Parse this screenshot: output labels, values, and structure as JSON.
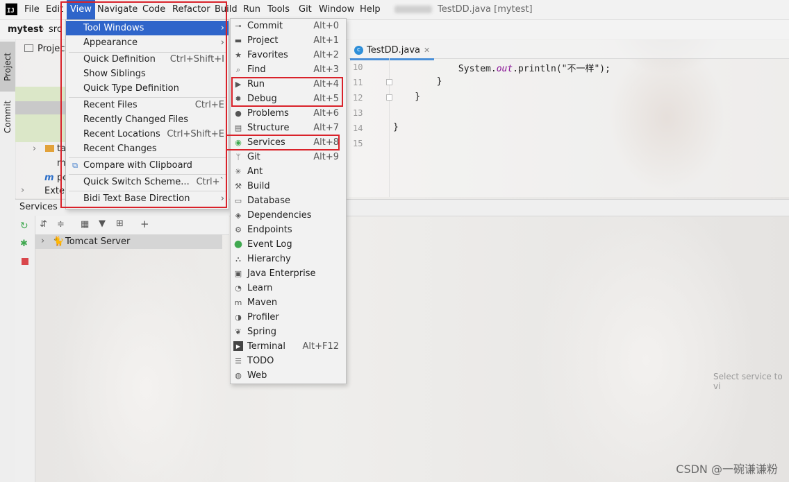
{
  "menubar": {
    "items": [
      "File",
      "Edit",
      "View",
      "Navigate",
      "Code",
      "Refactor",
      "Build",
      "Run",
      "Tools",
      "Git",
      "Window",
      "Help"
    ],
    "window_title": "TestDD.java [mytest]"
  },
  "navbar": {
    "project": "mytest",
    "crumb": "src"
  },
  "left_strip": {
    "project_tab": "Project",
    "commit_tab": "Commit"
  },
  "project_panel": {
    "header": "Project",
    "rows": [
      "ta",
      "m",
      "pc",
      "Exter"
    ]
  },
  "editor": {
    "tab_label": "TestDD.java",
    "lines": [
      {
        "num": "10",
        "code": "            System.out.println(\"不一样\");"
      },
      {
        "num": "11",
        "code": "        }"
      },
      {
        "num": "12",
        "code": "    }"
      },
      {
        "num": "13",
        "code": ""
      },
      {
        "num": "14",
        "code": "}"
      },
      {
        "num": "15",
        "code": ""
      }
    ],
    "out_token": "out"
  },
  "services": {
    "title": "Services",
    "tree_item": "Tomcat Server",
    "empty_hint": "Select service to vi"
  },
  "view_menu": {
    "items": [
      {
        "label": "Tool Windows",
        "shortcut": "",
        "submenu": true,
        "highlighted": true
      },
      {
        "label": "Appearance",
        "shortcut": "",
        "submenu": true
      },
      {
        "label": "Quick Definition",
        "shortcut": "Ctrl+Shift+I"
      },
      {
        "label": "Show Siblings",
        "shortcut": ""
      },
      {
        "label": "Quick Type Definition",
        "shortcut": ""
      },
      {
        "label": "Recent Files",
        "shortcut": "Ctrl+E"
      },
      {
        "label": "Recently Changed Files",
        "shortcut": ""
      },
      {
        "label": "Recent Locations",
        "shortcut": "Ctrl+Shift+E"
      },
      {
        "label": "Recent Changes",
        "shortcut": ""
      },
      {
        "label": "Compare with Clipboard",
        "shortcut": ""
      },
      {
        "label": "Quick Switch Scheme...",
        "shortcut": "Ctrl+`"
      },
      {
        "label": "Bidi Text Base Direction",
        "shortcut": "",
        "submenu": true
      }
    ]
  },
  "tool_windows_menu": {
    "items": [
      {
        "label": "Commit",
        "shortcut": "Alt+0",
        "icon": "commit-icon"
      },
      {
        "label": "Project",
        "shortcut": "Alt+1",
        "icon": "folder-icon"
      },
      {
        "label": "Favorites",
        "shortcut": "Alt+2",
        "icon": "star-icon"
      },
      {
        "label": "Find",
        "shortcut": "Alt+3",
        "icon": "search-icon"
      },
      {
        "label": "Run",
        "shortcut": "Alt+4",
        "icon": "play-icon"
      },
      {
        "label": "Debug",
        "shortcut": "Alt+5",
        "icon": "bug-icon"
      },
      {
        "label": "Problems",
        "shortcut": "Alt+6",
        "icon": "warning-icon"
      },
      {
        "label": "Structure",
        "shortcut": "Alt+7",
        "icon": "structure-icon"
      },
      {
        "label": "Services",
        "shortcut": "Alt+8",
        "icon": "services-icon"
      },
      {
        "label": "Git",
        "shortcut": "Alt+9",
        "icon": "git-icon"
      },
      {
        "label": "Ant",
        "shortcut": "",
        "icon": "ant-icon"
      },
      {
        "label": "Build",
        "shortcut": "",
        "icon": "hammer-icon"
      },
      {
        "label": "Database",
        "shortcut": "",
        "icon": "database-icon"
      },
      {
        "label": "Dependencies",
        "shortcut": "",
        "icon": "layers-icon"
      },
      {
        "label": "Endpoints",
        "shortcut": "",
        "icon": "endpoints-icon"
      },
      {
        "label": "Event Log",
        "shortcut": "",
        "icon": "event-log-icon"
      },
      {
        "label": "Hierarchy",
        "shortcut": "",
        "icon": "hierarchy-icon"
      },
      {
        "label": "Java Enterprise",
        "shortcut": "",
        "icon": "java-enterprise-icon"
      },
      {
        "label": "Learn",
        "shortcut": "",
        "icon": "learn-icon"
      },
      {
        "label": "Maven",
        "shortcut": "",
        "icon": "maven-icon"
      },
      {
        "label": "Profiler",
        "shortcut": "",
        "icon": "profiler-icon"
      },
      {
        "label": "Spring",
        "shortcut": "",
        "icon": "spring-icon"
      },
      {
        "label": "Terminal",
        "shortcut": "Alt+F12",
        "icon": "terminal-icon"
      },
      {
        "label": "TODO",
        "shortcut": "",
        "icon": "todo-icon"
      },
      {
        "label": "Web",
        "shortcut": "",
        "icon": "globe-icon"
      }
    ]
  },
  "watermark": "CSDN @一碗谦谦粉",
  "colors": {
    "selection": "#2f65ca",
    "highlight_box": "#d9222a",
    "event_log_green": "#3fa84f"
  }
}
